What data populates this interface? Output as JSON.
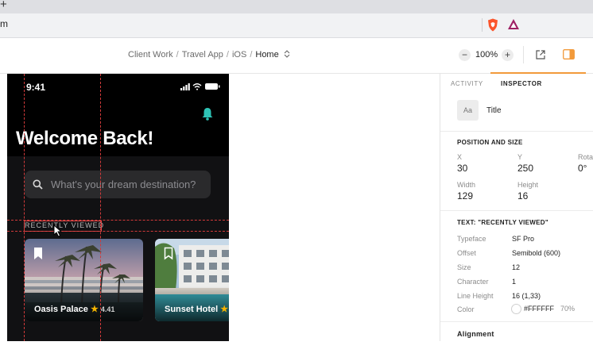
{
  "browser": {
    "new_tab_glyph": "+",
    "url": "m",
    "extensions": [
      "brave-shield-icon",
      "brave-rewards-icon"
    ],
    "brand_color": "#fb542b"
  },
  "toolbar": {
    "breadcrumb": [
      "Client Work",
      "Travel App",
      "iOS",
      "Home"
    ],
    "breadcrumb_sep": "/",
    "zoom": "100%",
    "zoom_minus": "−",
    "zoom_plus": "+",
    "accent": "#f29a3b"
  },
  "canvas": {
    "phone": {
      "time": "9:41",
      "greeting": "Welcome Back!",
      "search_placeholder": "What's your dream destination?",
      "section_label": "RECENTLY VIEWED",
      "bell_color": "#2ec4b6",
      "cards": [
        {
          "title": "Oasis Palace",
          "rating": "4.41"
        },
        {
          "title": "Sunset Hotel",
          "rating": ""
        }
      ]
    }
  },
  "panel": {
    "tabs": [
      "ACTIVITY",
      "INSPECTOR"
    ],
    "layer_icon_text": "Aa",
    "layer_name": "Title",
    "position_header": "POSITION AND SIZE",
    "x_label": "X",
    "x_value": "30",
    "y_label": "Y",
    "y_value": "250",
    "rot_label": "Rota",
    "rot_value": "0°",
    "w_label": "Width",
    "w_value": "129",
    "h_label": "Height",
    "h_value": "16",
    "text_header": "TEXT: \"RECENTLY VIEWED\"",
    "text_rows": [
      {
        "label": "Typeface",
        "value": "SF Pro"
      },
      {
        "label": "Offset",
        "value": "Semibold (600)"
      },
      {
        "label": "Size",
        "value": "12"
      },
      {
        "label": "Character",
        "value": "1"
      },
      {
        "label": "Line Height",
        "value": "16 (1,33)"
      },
      {
        "label": "Color",
        "value": "#FFFFFF"
      }
    ],
    "color_opacity": "70%",
    "alignment_header": "Alignment"
  }
}
